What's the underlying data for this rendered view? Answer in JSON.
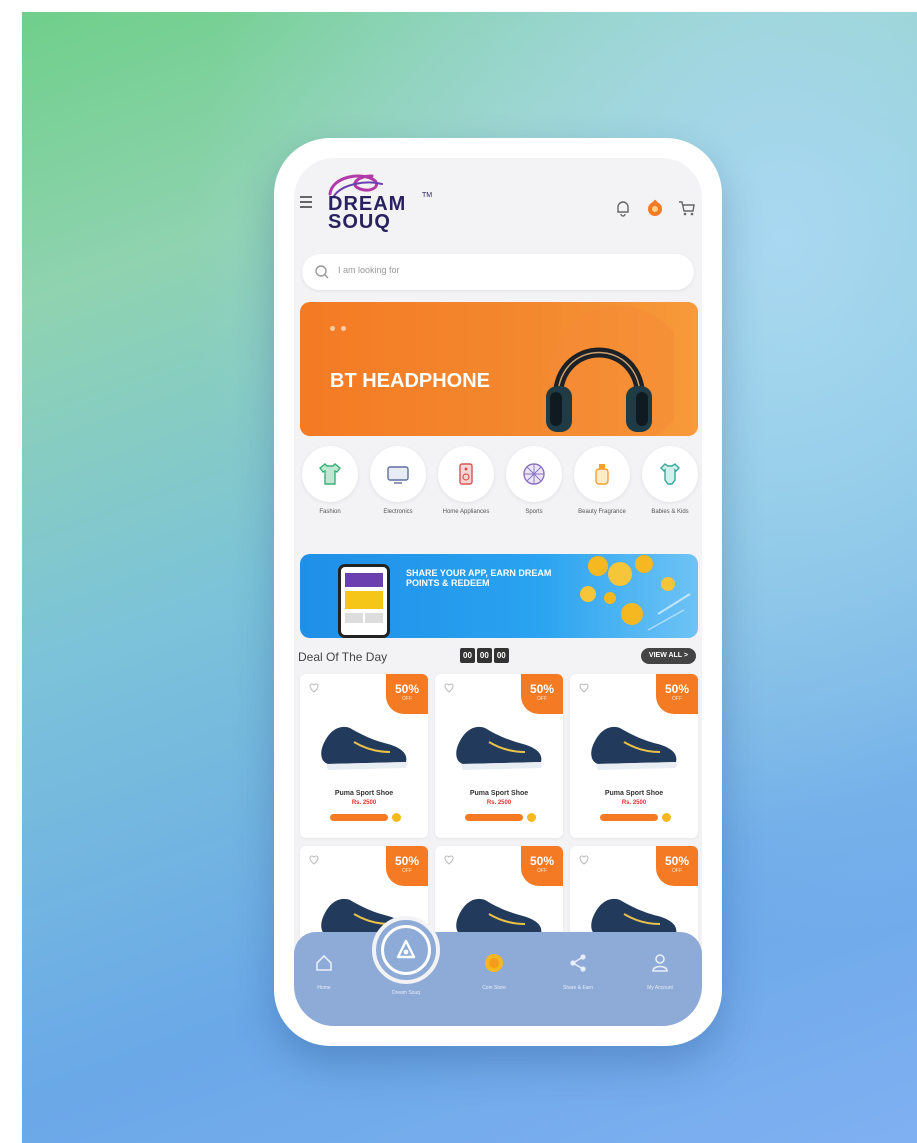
{
  "app": {
    "logo_line1": "DREAM",
    "logo_line2": "SOUQ",
    "logo_tm": "TM"
  },
  "search": {
    "placeholder": "I am looking for"
  },
  "hero": {
    "title": "BT HEADPHONE"
  },
  "categories": [
    {
      "label": "Fashion",
      "icon": "shirt-icon"
    },
    {
      "label": "Electronics",
      "icon": "tv-icon"
    },
    {
      "label": "Home Appliances",
      "icon": "speaker-icon"
    },
    {
      "label": "Sports",
      "icon": "ball-icon"
    },
    {
      "label": "Beauty Fragrance",
      "icon": "perfume-icon"
    },
    {
      "label": "Babies & Kids",
      "icon": "onesie-icon"
    }
  ],
  "promo": {
    "text": "SHARE YOUR APP, EARN DREAM POINTS & REDEEM"
  },
  "deal": {
    "title": "Deal Of The Day",
    "timer": [
      "00",
      "00",
      "00"
    ],
    "view_all": "VIEW ALL >"
  },
  "products": [
    {
      "name": "Puma Sport Shoe",
      "price": "Rs. 2500",
      "discount": "50%",
      "off": "OFF"
    },
    {
      "name": "Puma Sport Shoe",
      "price": "Rs. 2500",
      "discount": "50%",
      "off": "OFF"
    },
    {
      "name": "Puma Sport Shoe",
      "price": "Rs. 2500",
      "discount": "50%",
      "off": "OFF"
    },
    {
      "name": "",
      "price": "",
      "discount": "50%",
      "off": "OFF"
    },
    {
      "name": "",
      "price": "",
      "discount": "50%",
      "off": "OFF"
    },
    {
      "name": "",
      "price": "",
      "discount": "50%",
      "off": "OFF"
    }
  ],
  "bottom_nav": [
    {
      "label": "Home",
      "icon": "home-icon"
    },
    {
      "label": "Dream Souq",
      "icon": "dreamsouq-center-icon"
    },
    {
      "label": "Coin Store",
      "icon": "coin-icon"
    },
    {
      "label": "Share & Earn",
      "icon": "share-icon"
    },
    {
      "label": "My Account",
      "icon": "account-icon"
    }
  ],
  "colors": {
    "brand_orange": "#f47a24",
    "brand_navy": "#2a2260",
    "promo_blue": "#1f8fe8",
    "nav_blue": "#8eaad6"
  }
}
